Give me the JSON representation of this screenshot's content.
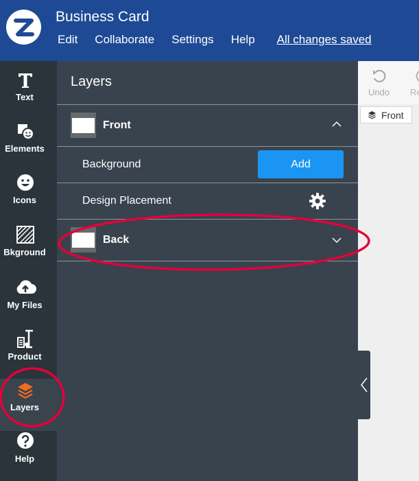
{
  "app": {
    "title": "Business Card",
    "menu": [
      "Edit",
      "Collaborate",
      "Settings",
      "Help"
    ],
    "save_status": "All changes saved"
  },
  "rail": {
    "items": [
      {
        "label": "Text",
        "icon": "text-icon"
      },
      {
        "label": "Elements",
        "icon": "elements-icon"
      },
      {
        "label": "Icons",
        "icon": "smiley-icon"
      },
      {
        "label": "Bkground",
        "icon": "background-hatch-icon"
      },
      {
        "label": "My Files",
        "icon": "cloud-upload-icon"
      },
      {
        "label": "Product",
        "icon": "product-icon"
      },
      {
        "label": "Layers",
        "icon": "layers-icon"
      },
      {
        "label": "Help",
        "icon": "help-icon"
      }
    ],
    "active": "Layers"
  },
  "panel": {
    "title": "Layers",
    "front": {
      "label": "Front",
      "background_label": "Background",
      "add_label": "Add",
      "placement_label": "Design Placement"
    },
    "back": {
      "label": "Back"
    }
  },
  "canvas": {
    "undo_label": "Undo",
    "redo_label": "Redo",
    "face_label": "Front"
  },
  "colors": {
    "header": "#1e4a95",
    "rail": "#2b343b",
    "panel": "#38434d",
    "accent": "#1a95f3",
    "layers_active": "#f26b21",
    "annotation": "#e4003b"
  }
}
